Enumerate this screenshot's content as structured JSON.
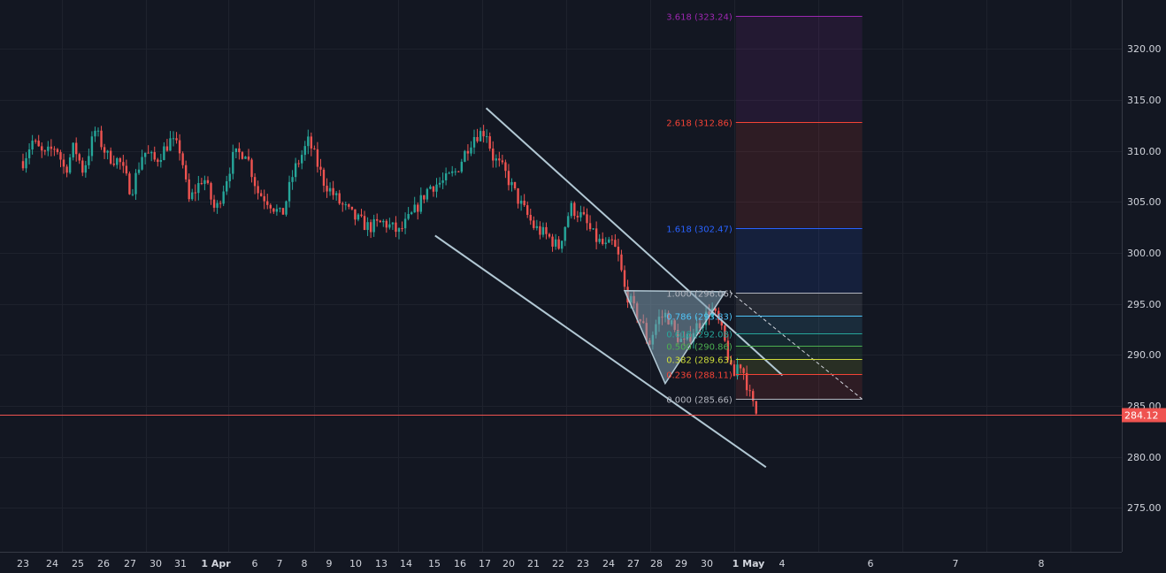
{
  "chart_data": {
    "type": "candlestick",
    "theme": {
      "background": "#131722",
      "grid": "#1e222d",
      "axis_text": "#d1d4dc",
      "up": "#26a69a",
      "down": "#ef5350"
    },
    "y_axis": {
      "range": [
        270.7,
        324.8
      ],
      "ticks": [
        "320.00",
        "315.00",
        "310.00",
        "305.00",
        "300.00",
        "295.00",
        "290.00",
        "285.00",
        "280.00",
        "275.00"
      ],
      "position": "right"
    },
    "x_axis": {
      "ticks": [
        {
          "label": "23",
          "bold": false
        },
        {
          "label": "24",
          "bold": false
        },
        {
          "label": "25",
          "bold": false
        },
        {
          "label": "26",
          "bold": false
        },
        {
          "label": "27",
          "bold": false
        },
        {
          "label": "30",
          "bold": false
        },
        {
          "label": "31",
          "bold": false
        },
        {
          "label": "1 Apr",
          "bold": true
        },
        {
          "label": "6",
          "bold": false
        },
        {
          "label": "7",
          "bold": false
        },
        {
          "label": "8",
          "bold": false
        },
        {
          "label": "9",
          "bold": false
        },
        {
          "label": "10",
          "bold": false
        },
        {
          "label": "13",
          "bold": false
        },
        {
          "label": "14",
          "bold": false
        },
        {
          "label": "15",
          "bold": false
        },
        {
          "label": "16",
          "bold": false
        },
        {
          "label": "17",
          "bold": false
        },
        {
          "label": "20",
          "bold": false
        },
        {
          "label": "21",
          "bold": false
        },
        {
          "label": "22",
          "bold": false
        },
        {
          "label": "23",
          "bold": false
        },
        {
          "label": "24",
          "bold": false
        },
        {
          "label": "27",
          "bold": false
        },
        {
          "label": "28",
          "bold": false
        },
        {
          "label": "29",
          "bold": false
        },
        {
          "label": "30",
          "bold": false
        },
        {
          "label": "1 May",
          "bold": true
        },
        {
          "label": "4",
          "bold": false
        },
        {
          "label": "6",
          "bold": false
        },
        {
          "label": "7",
          "bold": false
        },
        {
          "label": "8",
          "bold": false
        }
      ]
    },
    "last_price": {
      "value": 284.12,
      "label": "284.12",
      "color": "#ef5350"
    },
    "anchors": [
      {
        "t": 0,
        "p": 309.0
      },
      {
        "t": 0.06,
        "p": 311.0
      },
      {
        "t": 0.14,
        "p": 309.5
      },
      {
        "t": 0.22,
        "p": 310.5
      },
      {
        "t": 0.28,
        "p": 308.0
      },
      {
        "t": 0.34,
        "p": 310.5
      },
      {
        "t": 0.4,
        "p": 308.0
      },
      {
        "t": 0.48,
        "p": 312.0
      },
      {
        "t": 0.56,
        "p": 309.5
      },
      {
        "t": 0.64,
        "p": 309.0
      },
      {
        "t": 0.72,
        "p": 306.0
      },
      {
        "t": 0.8,
        "p": 310.0
      },
      {
        "t": 0.88,
        "p": 309.0
      },
      {
        "t": 0.98,
        "p": 311.0
      },
      {
        "t": 1.05,
        "p": 310.0
      },
      {
        "t": 1.1,
        "p": 305.0
      },
      {
        "t": 1.2,
        "p": 307.5
      },
      {
        "t": 1.28,
        "p": 304.0
      },
      {
        "t": 1.4,
        "p": 309.5
      },
      {
        "t": 1.48,
        "p": 310.0
      },
      {
        "t": 1.56,
        "p": 306.0
      },
      {
        "t": 1.64,
        "p": 305.0
      },
      {
        "t": 1.72,
        "p": 303.5
      },
      {
        "t": 1.8,
        "p": 308.0
      },
      {
        "t": 1.9,
        "p": 311.0
      },
      {
        "t": 2.0,
        "p": 307.0
      },
      {
        "t": 2.1,
        "p": 305.0
      },
      {
        "t": 2.2,
        "p": 303.5
      },
      {
        "t": 2.3,
        "p": 302.5
      },
      {
        "t": 2.4,
        "p": 303.0
      },
      {
        "t": 2.5,
        "p": 302.0
      },
      {
        "t": 2.6,
        "p": 304.0
      },
      {
        "t": 2.7,
        "p": 306.5
      },
      {
        "t": 2.8,
        "p": 307.0
      },
      {
        "t": 2.88,
        "p": 308.0
      },
      {
        "t": 2.96,
        "p": 310.5
      },
      {
        "t": 3.0,
        "p": 311.5
      },
      {
        "t": 3.08,
        "p": 312.0
      },
      {
        "t": 3.12,
        "p": 309.5
      },
      {
        "t": 3.2,
        "p": 308.0
      },
      {
        "t": 3.3,
        "p": 305.0
      },
      {
        "t": 3.4,
        "p": 302.5
      },
      {
        "t": 3.5,
        "p": 301.5
      },
      {
        "t": 3.56,
        "p": 300.5
      },
      {
        "t": 3.64,
        "p": 304.5
      },
      {
        "t": 3.72,
        "p": 303.5
      },
      {
        "t": 3.8,
        "p": 301.5
      },
      {
        "t": 3.88,
        "p": 300.5
      },
      {
        "t": 3.92,
        "p": 301.0
      },
      {
        "t": 3.96,
        "p": 299.5
      },
      {
        "t": 4.0,
        "p": 296.5
      },
      {
        "t": 4.06,
        "p": 294.5
      },
      {
        "t": 4.12,
        "p": 293.0
      },
      {
        "t": 4.16,
        "p": 291.0
      },
      {
        "t": 4.22,
        "p": 293.5
      },
      {
        "t": 4.28,
        "p": 294.0
      },
      {
        "t": 4.34,
        "p": 292.0
      },
      {
        "t": 4.4,
        "p": 291.0
      },
      {
        "t": 4.46,
        "p": 292.5
      },
      {
        "t": 4.52,
        "p": 293.5
      },
      {
        "t": 4.58,
        "p": 294.5
      },
      {
        "t": 4.63,
        "p": 293.0
      },
      {
        "t": 4.68,
        "p": 290.5
      },
      {
        "t": 4.72,
        "p": 287.5
      },
      {
        "t": 4.76,
        "p": 289.5
      },
      {
        "t": 4.8,
        "p": 288.0
      },
      {
        "t": 4.84,
        "p": 285.5
      },
      {
        "t": 4.88,
        "p": 284.12
      }
    ],
    "overlays": {
      "channel_upper": {
        "from": {
          "t": 3.08,
          "p": 314.2
        },
        "to": {
          "t": 5.05,
          "p": 288.0
        },
        "color": "#b2c8d4"
      },
      "channel_lower": {
        "from": {
          "t": 2.74,
          "p": 301.7
        },
        "to": {
          "t": 4.94,
          "p": 279.0
        },
        "color": "#b2c8d4"
      },
      "triangle": {
        "points": [
          {
            "t": 4.0,
            "p": 296.3
          },
          {
            "t": 4.27,
            "p": 287.2
          },
          {
            "t": 4.67,
            "p": 296.2
          }
        ],
        "fill": "#7f9caf",
        "stroke": "#b2c8d4"
      },
      "fib_trend_line": {
        "from": {
          "t": 4.7,
          "p": 296.2
        },
        "to": {
          "t": 5.58,
          "p": 285.66
        },
        "color": "#d1d4dc"
      },
      "fib_range": {
        "t_start": 4.74,
        "t_end": 5.58
      },
      "fib_levels": [
        {
          "ratio": "3.618",
          "price": 323.24,
          "color": "#9c27b0",
          "label": "3.618 (323.24)"
        },
        {
          "ratio": "2.618",
          "price": 312.86,
          "color": "#f44336",
          "label": "2.618 (312.86)"
        },
        {
          "ratio": "1.618",
          "price": 302.47,
          "color": "#2962ff",
          "label": "1.618 (302.47)"
        },
        {
          "ratio": "1.000",
          "price": 296.06,
          "color": "#b2b5be",
          "label": "1.000 (296.06)"
        },
        {
          "ratio": "0.786",
          "price": 293.83,
          "color": "#4fc3f7",
          "label": "0.786 (293.83)"
        },
        {
          "ratio": "0.618",
          "price": 292.08,
          "color": "#26a69a",
          "label": "0.618 (292.08)"
        },
        {
          "ratio": "0.500",
          "price": 290.86,
          "color": "#4caf50",
          "label": "0.500 (290.86)"
        },
        {
          "ratio": "0.382",
          "price": 289.63,
          "color": "#cddc39",
          "label": "0.382 (289.63)"
        },
        {
          "ratio": "0.236",
          "price": 288.11,
          "color": "#f44336",
          "label": "0.236 (288.11)"
        },
        {
          "ratio": "0.000",
          "price": 285.66,
          "color": "#b2b5be",
          "label": "0.000 (285.66)"
        }
      ],
      "fib_bands": [
        {
          "from": 323.24,
          "to": 312.86,
          "color": "#9c27b0"
        },
        {
          "from": 312.86,
          "to": 302.47,
          "color": "#f44336"
        },
        {
          "from": 302.47,
          "to": 296.06,
          "color": "#2962ff"
        },
        {
          "from": 296.06,
          "to": 293.83,
          "color": "#b2b5be"
        },
        {
          "from": 293.83,
          "to": 292.08,
          "color": "#4fc3f7"
        },
        {
          "from": 292.08,
          "to": 290.86,
          "color": "#26a69a"
        },
        {
          "from": 290.86,
          "to": 289.63,
          "color": "#4caf50"
        },
        {
          "from": 289.63,
          "to": 288.11,
          "color": "#cddc39"
        },
        {
          "from": 288.11,
          "to": 285.66,
          "color": "#f44336"
        }
      ]
    }
  }
}
